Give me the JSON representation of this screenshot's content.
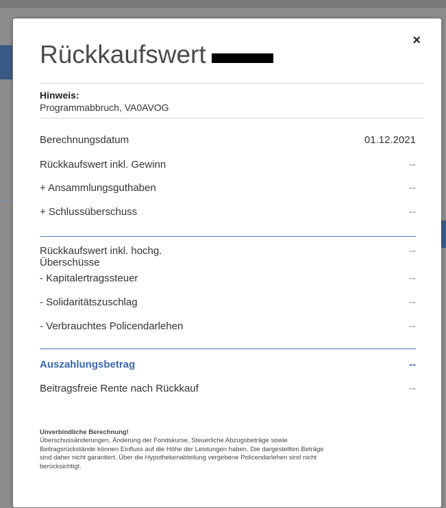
{
  "modal": {
    "title": "Rückkaufswert",
    "close_label": "×"
  },
  "hint": {
    "label": "Hinweis:",
    "text": "Programmabbruch, VA0AVOG"
  },
  "rows": [
    {
      "label": "Berechnungsdatum",
      "value": "01.12.2021"
    },
    {
      "label": "Rückkaufswert inkl. Gewinn",
      "value": "--"
    },
    {
      "label": "+ Ansammlungsguthaben",
      "value": "--"
    },
    {
      "label": "+ Schlussüberschuss",
      "value": "--"
    }
  ],
  "rows2": [
    {
      "label": "Rückkaufswert inkl. hochg.",
      "label2": "Überschüsse",
      "value": "--"
    },
    {
      "label": "- Kapitalertragssteuer",
      "value": "--"
    },
    {
      "label": "- Solidaritätszuschlag",
      "value": "--"
    },
    {
      "label": "- Verbrauchtes Policendarlehen",
      "value": "--"
    }
  ],
  "payout": {
    "label": "Auszahlungsbetrag",
    "value": "--"
  },
  "pension": {
    "label": "Beitragsfreie Rente nach Rückkauf",
    "value": "--"
  },
  "footnote": {
    "title": "Unverbindliche Berechnung!",
    "line1": "Überschussänderungen, Änderung der Fondskurse, Steuerliche Abzugsbeträge sowie",
    "line2": "Beitragsrückstände können Einfluss auf die Höhe der Leistungen haben. Die dargestellten Beträge",
    "line3": "sind daher nicht garantiert. Über die Hypothekenabteilung vergebene Policendarlehen sind nicht",
    "line4": "berücksichtigt."
  }
}
